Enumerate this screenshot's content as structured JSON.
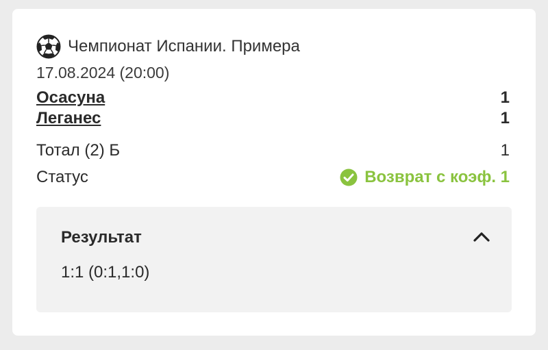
{
  "league": {
    "icon": "soccer-ball-icon",
    "title": "Чемпионат Испании. Примера"
  },
  "match": {
    "datetime": "17.08.2024 (20:00)",
    "home_team": "Осасуна",
    "home_score": "1",
    "away_team": "Леганес",
    "away_score": "1"
  },
  "bet": {
    "market_label": "Тотал (2) Б",
    "market_value": "1",
    "status_label": "Статус",
    "status_value": "Возврат с коэф. 1",
    "status_icon": "check-circle-icon",
    "status_color": "#8ac33f"
  },
  "result": {
    "title": "Результат",
    "value": "1:1 (0:1,1:0)",
    "toggle_icon": "chevron-up-icon",
    "expanded": true
  }
}
